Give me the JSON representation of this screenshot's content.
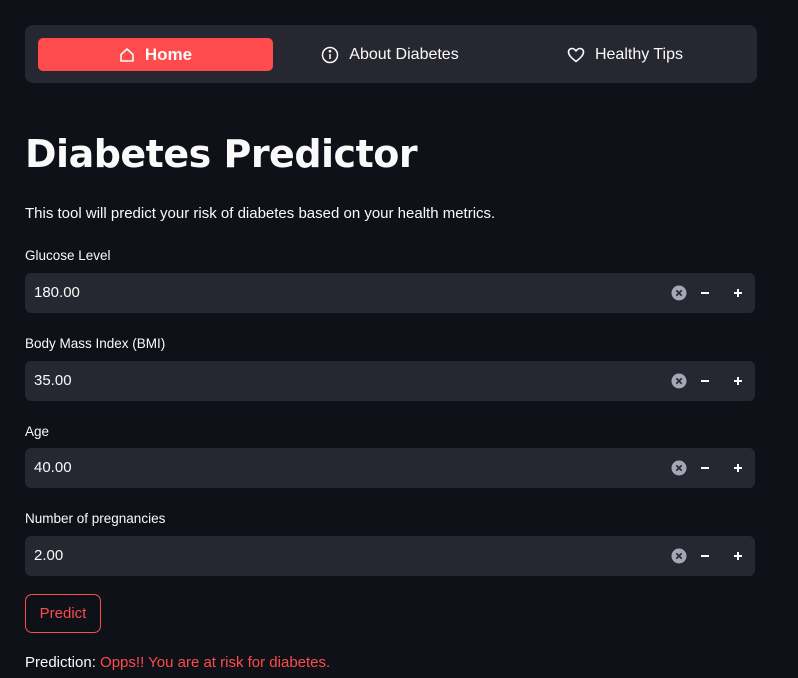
{
  "nav": {
    "items": [
      {
        "label": "Home",
        "icon": "home-icon",
        "active": true
      },
      {
        "label": "About Diabetes",
        "icon": "info-icon",
        "active": false
      },
      {
        "label": "Healthy Tips",
        "icon": "heart-icon",
        "active": false
      }
    ]
  },
  "page": {
    "title": "Diabetes Predictor",
    "subtitle": "This tool will predict your risk of diabetes based on your health metrics."
  },
  "fields": [
    {
      "label": "Glucose Level",
      "value": "180.00"
    },
    {
      "label": "Body Mass Index (BMI)",
      "value": "35.00"
    },
    {
      "label": "Age",
      "value": "40.00"
    },
    {
      "label": "Number of pregnancies",
      "value": "2.00"
    }
  ],
  "predict_button": {
    "label": "Predict"
  },
  "prediction": {
    "label": "Prediction:",
    "result": "Opps!! You are at risk for diabetes."
  },
  "colors": {
    "background": "#0e1117",
    "surface": "#262730",
    "accent": "#ff4b4b",
    "text": "#fafafa"
  }
}
